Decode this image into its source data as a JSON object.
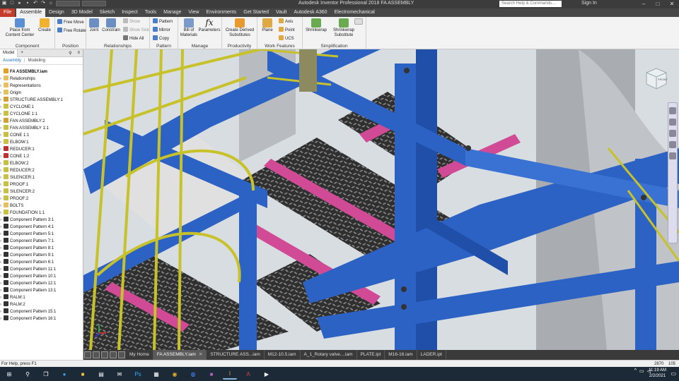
{
  "titlebar": {
    "title": "Autodesk Inventor Professional 2018   FA ASSEMBLY",
    "search_placeholder": "Search Help & Commands...",
    "sign_in": "Sign In"
  },
  "menu_tabs": [
    "File",
    "Assemble",
    "Design",
    "3D Model",
    "Sketch",
    "Inspect",
    "Tools",
    "Manage",
    "View",
    "Environments",
    "Get Started",
    "Vault",
    "Autodesk A360",
    "Electromechanical"
  ],
  "ribbon": {
    "component": {
      "title": "Component",
      "place": "Place from\nContent Center",
      "create": "Create"
    },
    "position": {
      "title": "Position",
      "free_move": "Free Move",
      "free_rotate": "Free Rotate"
    },
    "relationships": {
      "title": "Relationships",
      "joint": "Joint",
      "constrain": "Constrain",
      "show": "Show",
      "show_sick": "Show Sick",
      "hide_all": "Hide All"
    },
    "pattern": {
      "title": "Pattern",
      "pattern": "Pattern",
      "mirror": "Mirror",
      "copy": "Copy"
    },
    "manage": {
      "title": "Manage",
      "bom": "Bill of\nMaterials",
      "params": "Parameters"
    },
    "productivity": {
      "title": "Productivity",
      "create_derived": "Create Derived\nSubstitutes"
    },
    "work_features": {
      "title": "Work Features",
      "plane": "Plane",
      "axis": "Axis",
      "point": "Point",
      "ucs": "UCS"
    },
    "simplification": {
      "title": "Simplification",
      "shrinkwrap": "Shrinkwrap",
      "shrinkwrap_sub": "Shrinkwrap\nSubstitute"
    }
  },
  "browser": {
    "tab_model": "Model",
    "tab_plus": "+",
    "sub_assembly": "Assembly",
    "sub_modeling": "Modeling",
    "items": [
      {
        "label": "FA ASSEMBLY.iam",
        "root": true,
        "color": "#e0a020"
      },
      {
        "label": "Relationships",
        "color": "#e8c060"
      },
      {
        "label": "Representations",
        "color": "#e8c060"
      },
      {
        "label": "Origin",
        "color": "#e8c060"
      },
      {
        "label": "STRUCTURE ASSEMBLY:1",
        "color": "#d0a030"
      },
      {
        "label": "CYCLONE:1",
        "color": "#c8c040"
      },
      {
        "label": "CYCLONE 1:1",
        "color": "#c8c040"
      },
      {
        "label": "FAN ASSEMBLY:2",
        "color": "#d0a030"
      },
      {
        "label": "FAN ASSEMBLY 1:1",
        "color": "#c8c040"
      },
      {
        "label": "CONE 1:1",
        "color": "#c8c040"
      },
      {
        "label": "ELBOW:1",
        "color": "#c8c040"
      },
      {
        "label": "REDUCER:1",
        "color": "#c03030"
      },
      {
        "label": "CONE 1:2",
        "color": "#c03030"
      },
      {
        "label": "ELBOW:2",
        "color": "#c8c040"
      },
      {
        "label": "REDUCER:2",
        "color": "#c8c040"
      },
      {
        "label": "SILENCER:1",
        "color": "#c8c040"
      },
      {
        "label": "PROOF:1",
        "color": "#c8c040"
      },
      {
        "label": "SILENCER:2",
        "color": "#c8c040"
      },
      {
        "label": "PROOF:2",
        "color": "#c8c040"
      },
      {
        "label": "BOLTS",
        "color": "#e8c060"
      },
      {
        "label": "FOUNDATION 1:1",
        "color": "#c8c040"
      },
      {
        "label": "Component Pattern 3:1",
        "color": "#333"
      },
      {
        "label": "Component Pattern 4:1",
        "color": "#333"
      },
      {
        "label": "Component Pattern 5:1",
        "color": "#333"
      },
      {
        "label": "Component Pattern 7:1",
        "color": "#333"
      },
      {
        "label": "Component Pattern 8:1",
        "color": "#333"
      },
      {
        "label": "Component Pattern 9:1",
        "color": "#333"
      },
      {
        "label": "Component Pattern 6:1",
        "color": "#333"
      },
      {
        "label": "Component Pattern 11:1",
        "color": "#333"
      },
      {
        "label": "Component Pattern 10:1",
        "color": "#333"
      },
      {
        "label": "Component Pattern 12:1",
        "color": "#333"
      },
      {
        "label": "Component Pattern 13:1",
        "color": "#333"
      },
      {
        "label": "RALM:1",
        "color": "#333"
      },
      {
        "label": "RALM:2",
        "color": "#333"
      },
      {
        "label": "Component Pattern 15:1",
        "color": "#333"
      },
      {
        "label": "Component Pattern 16:1",
        "color": "#333"
      }
    ]
  },
  "viewcube_label": "FRONT",
  "doc_tabs": [
    {
      "label": "My Home",
      "active": false
    },
    {
      "label": "FA ASSEMBLY.iam",
      "active": true
    },
    {
      "label": "STRUCTURE ASS...iam",
      "active": false
    },
    {
      "label": "M12-10.5.iam",
      "active": false
    },
    {
      "label": "A_1_Rotary valve....iam",
      "active": false
    },
    {
      "label": "PLATE.ipt",
      "active": false
    },
    {
      "label": "M16-16.iam",
      "active": false
    },
    {
      "label": "LADER.ipt",
      "active": false
    }
  ],
  "status": {
    "help": "For Help, press F1",
    "n1": "2870",
    "n2": "105"
  },
  "clock": {
    "time": "11:19 AM",
    "date": "2/2/2021"
  },
  "colors": {
    "steel_blue": "#2b62c4",
    "yellow_rail": "#c7c22a",
    "magenta_beam": "#d04a96",
    "grating": "#4a4a4a"
  }
}
